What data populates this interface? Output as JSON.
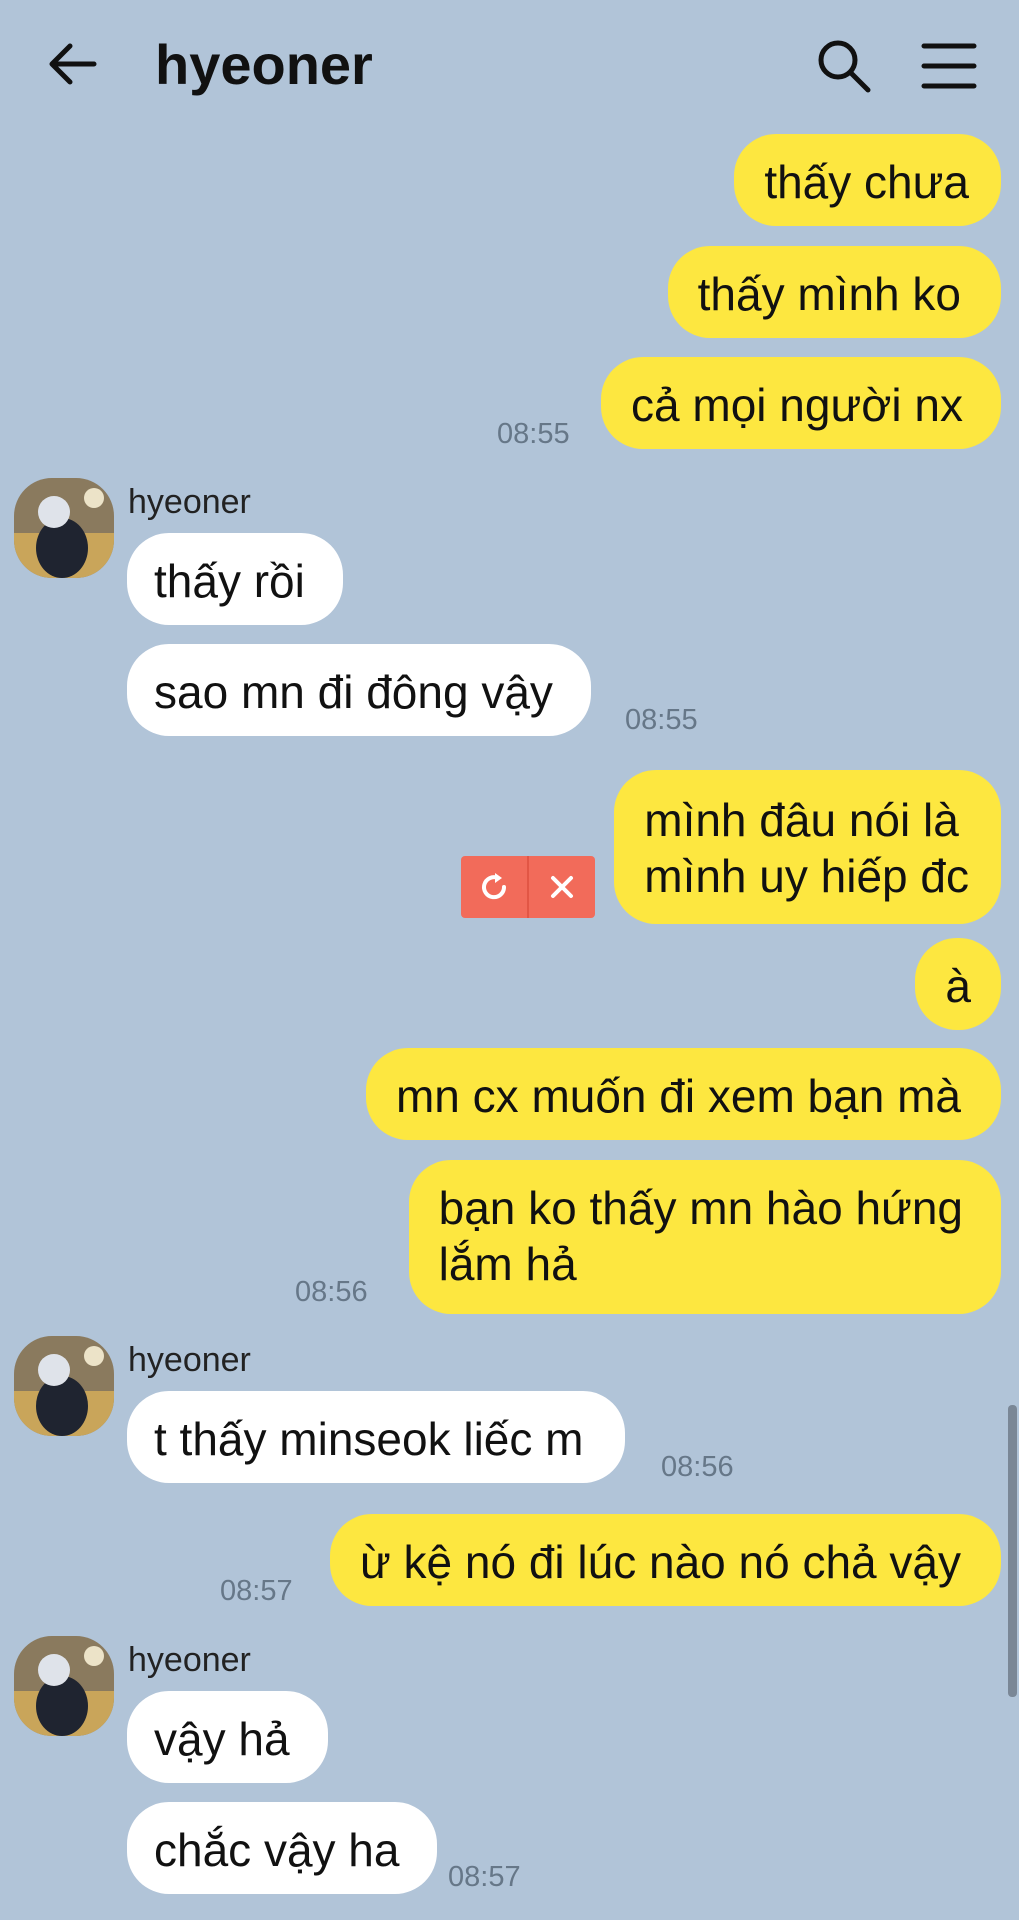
{
  "header": {
    "title": "hyeoner",
    "back_icon": "arrow-left-icon",
    "search_icon": "search-icon",
    "menu_icon": "hamburger-menu-icon"
  },
  "colors": {
    "background": "#b1c4d8",
    "my_bubble": "#fde740",
    "their_bubble": "#ffffff",
    "failed_action": "#f26b5a"
  },
  "messages": {
    "m1": "thấy chưa",
    "m2": "thấy mình ko",
    "m3": "cả mọi người nx",
    "t1": "08:55",
    "s1": "hyeoner",
    "m4": "thấy rồi",
    "m5": "sao mn đi đông vậy",
    "t2": "08:55",
    "m6a": "mình đâu nói là",
    "m6b": "mình uy hiếp đc",
    "m7": "à",
    "m8": "mn cx muốn đi xem bạn mà",
    "m9a": "bạn ko thấy mn hào hứng",
    "m9b": "lắm hả",
    "t3": "08:56",
    "s2": "hyeoner",
    "m10": "t thấy minseok liếc m",
    "t4": "08:56",
    "m11": "ừ kệ nó đi lúc nào nó chả vậy",
    "t5": "08:57",
    "s3": "hyeoner",
    "m12": "vậy hả",
    "m13": "chắc vậy ha",
    "t6": "08:57"
  },
  "failed_send": {
    "retry_icon": "retry-icon",
    "delete_icon": "close-icon"
  }
}
